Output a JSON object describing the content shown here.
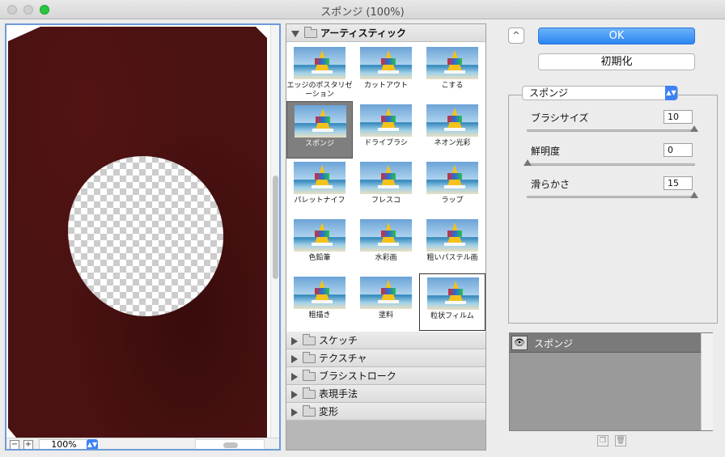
{
  "window": {
    "title": "スポンジ (100%)"
  },
  "preview": {
    "zoom": "100%",
    "zoom_out": "−",
    "zoom_in": "+"
  },
  "gallery": {
    "open_category": "アーティスティック",
    "filters": [
      {
        "label": "エッジのポスタリゼーション"
      },
      {
        "label": "カットアウト"
      },
      {
        "label": "こする"
      },
      {
        "label": "スポンジ",
        "selected": true
      },
      {
        "label": "ドライブラシ"
      },
      {
        "label": "ネオン光彩"
      },
      {
        "label": "パレットナイフ"
      },
      {
        "label": "フレスコ"
      },
      {
        "label": "ラップ"
      },
      {
        "label": "色鉛筆"
      },
      {
        "label": "水彩画"
      },
      {
        "label": "粗いパステル画"
      },
      {
        "label": "粗描き"
      },
      {
        "label": "塗料"
      },
      {
        "label": "粒状フィルム"
      }
    ],
    "categories": [
      "スケッチ",
      "テクスチャ",
      "ブラシストローク",
      "表現手法",
      "変形"
    ]
  },
  "right_panel": {
    "collapse_label": "^",
    "ok_label": "OK",
    "reset_label": "初期化",
    "filter_select": "スポンジ",
    "params": [
      {
        "label": "ブラシサイズ",
        "value": "10",
        "fraction": 1.0
      },
      {
        "label": "鮮明度",
        "value": "0",
        "fraction": 0.0
      },
      {
        "label": "滑らかさ",
        "value": "15",
        "fraction": 1.0
      }
    ],
    "layer_name": "スポンジ"
  },
  "colors": {
    "accent": "#2a85f1",
    "preview_bg": "#4a1212"
  }
}
